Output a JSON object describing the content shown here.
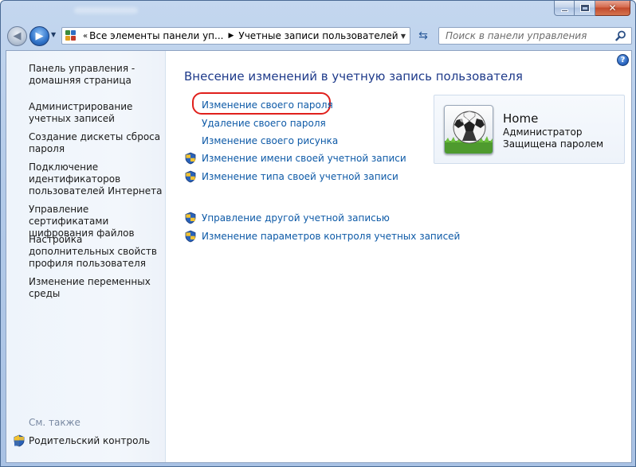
{
  "window": {
    "minimize_label": "–",
    "close_label": "✕"
  },
  "navigation": {
    "back_glyph": "◀",
    "forward_glyph": "▶",
    "history_glyph": "▼",
    "address": {
      "overflow_chevron": "«",
      "segments": [
        "Все элементы панели уп...",
        "Учетные записи пользователей"
      ],
      "separator_glyph": "▶",
      "dropdown_glyph": "▼"
    },
    "refresh_glyph": "⇆",
    "search": {
      "placeholder": "Поиск в панели управления"
    }
  },
  "sidebar": {
    "items": [
      {
        "label": "Панель управления - домашняя страница"
      },
      {
        "label": "Администрирование учетных записей"
      },
      {
        "label": "Создание дискеты сброса пароля"
      },
      {
        "label": "Подключение идентификаторов пользователей Интернета"
      },
      {
        "label": "Управление сертификатами шифрования файлов"
      },
      {
        "label": "Настройка дополнительных свойств профиля пользователя"
      },
      {
        "label": "Изменение переменных среды"
      }
    ],
    "see_also": "См. также",
    "parental_control": "Родительский контроль"
  },
  "main": {
    "help_label": "?",
    "title": "Внесение изменений в учетную запись пользователя",
    "tasks": [
      {
        "label": "Изменение своего пароля",
        "shield": false,
        "highlighted": true
      },
      {
        "label": "Удаление своего пароля",
        "shield": false
      },
      {
        "label": "Изменение своего рисунка",
        "shield": false
      },
      {
        "label": "Изменение имени своей учетной записи",
        "shield": true
      },
      {
        "label": "Изменение типа своей учетной записи",
        "shield": true
      }
    ],
    "other_tasks": [
      {
        "label": "Управление другой учетной записью",
        "shield": true
      },
      {
        "label": "Изменение параметров контроля учетных записей",
        "shield": true
      }
    ],
    "account": {
      "name": "Home",
      "role": "Администратор",
      "status": "Защищена паролем",
      "picture": "soccer-ball-icon"
    }
  },
  "colors": {
    "link": "#0e5aa7",
    "title": "#1e3a8a",
    "highlight_ring": "#e0201c"
  }
}
